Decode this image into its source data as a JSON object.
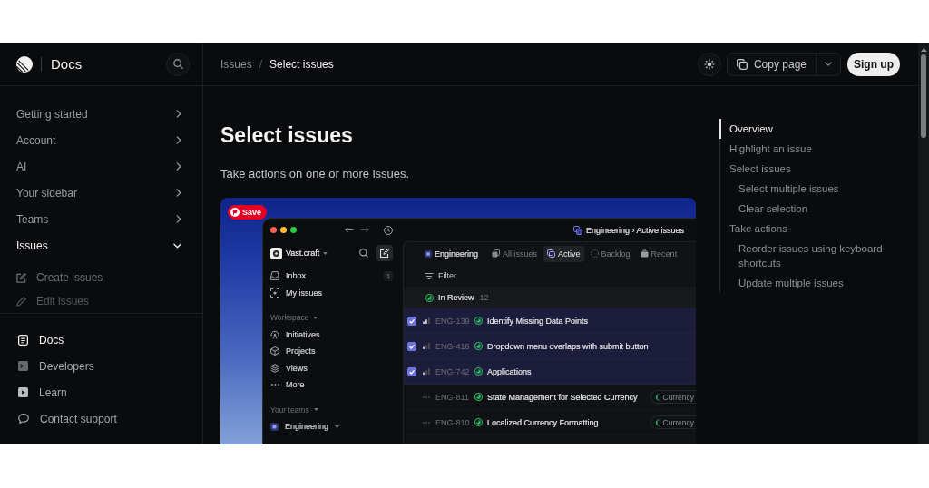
{
  "sidebar": {
    "title": "Docs",
    "nav": [
      {
        "label": "Getting started",
        "expanded": false
      },
      {
        "label": "Account",
        "expanded": false
      },
      {
        "label": "AI",
        "expanded": false
      },
      {
        "label": "Your sidebar",
        "expanded": false
      },
      {
        "label": "Teams",
        "expanded": false
      },
      {
        "label": "Issues",
        "expanded": true,
        "children": [
          {
            "label": "Create issues"
          },
          {
            "label": "Edit issues"
          }
        ]
      }
    ],
    "links": [
      {
        "label": "Docs",
        "selected": true
      },
      {
        "label": "Developers",
        "selected": false
      },
      {
        "label": "Learn",
        "selected": false
      },
      {
        "label": "Contact support",
        "selected": false
      }
    ]
  },
  "topbar": {
    "breadcrumb": {
      "parent": "Issues",
      "separator": "/",
      "current": "Select issues"
    },
    "copy_button": "Copy page",
    "signup_button": "Sign up"
  },
  "article": {
    "title": "Select issues",
    "subtitle": "Take actions on one or more issues.",
    "screenshot": {
      "save_button": "Save",
      "app": {
        "path": "Engineering › Active issues",
        "workspace": "Vast.craft",
        "nav": [
          {
            "label": "Inbox",
            "count": "1"
          },
          {
            "label": "My issues"
          }
        ],
        "sections": [
          {
            "title": "Workspace",
            "expanded": true,
            "items": [
              {
                "label": "Initiatives"
              },
              {
                "label": "Projects"
              },
              {
                "label": "Views"
              },
              {
                "label": "More"
              }
            ]
          },
          {
            "title": "Your teams",
            "expanded": true,
            "items": [
              {
                "label": "Engineering",
                "expanded": true
              }
            ]
          }
        ],
        "team": "Engineering",
        "tabs": [
          {
            "label": "All issues",
            "selected": false
          },
          {
            "label": "Active",
            "selected": true
          },
          {
            "label": "Backlog",
            "selected": false
          },
          {
            "label": "Recent",
            "selected": false
          }
        ],
        "filter": "Filter",
        "group": {
          "label": "In Review",
          "count": "12"
        },
        "issues": [
          {
            "id": "ENG-139",
            "title": "Identify Missing Data Points",
            "kind": "medium",
            "selected": true
          },
          {
            "id": "ENG-416",
            "title": "Dropdown menu overlaps with submit button",
            "kind": "low",
            "selected": true
          },
          {
            "id": "ENG-742",
            "title": "Applications",
            "kind": "low",
            "selected": true
          },
          {
            "id": "ENG-811",
            "title": "State Management for Selected Currency",
            "kind": "none",
            "selected": false,
            "tag": "Currency"
          },
          {
            "id": "ENG-810",
            "title": "Localized Currency Formatting",
            "kind": "none",
            "selected": false,
            "tag": "Currency"
          }
        ]
      }
    }
  },
  "toc": [
    {
      "label": "Overview",
      "selected": true
    },
    {
      "label": "Highlight an issue",
      "selected": false
    },
    {
      "label": "Select issues",
      "selected": false,
      "children": [
        {
          "label": "Select multiple issues",
          "selected": false
        },
        {
          "label": "Clear selection",
          "selected": false
        }
      ]
    },
    {
      "label": "Take actions",
      "selected": false,
      "children": [
        {
          "label": "Reorder issues using keyboard shortcuts",
          "selected": false
        },
        {
          "label": "Update multiple issues",
          "selected": false
        }
      ]
    }
  ]
}
